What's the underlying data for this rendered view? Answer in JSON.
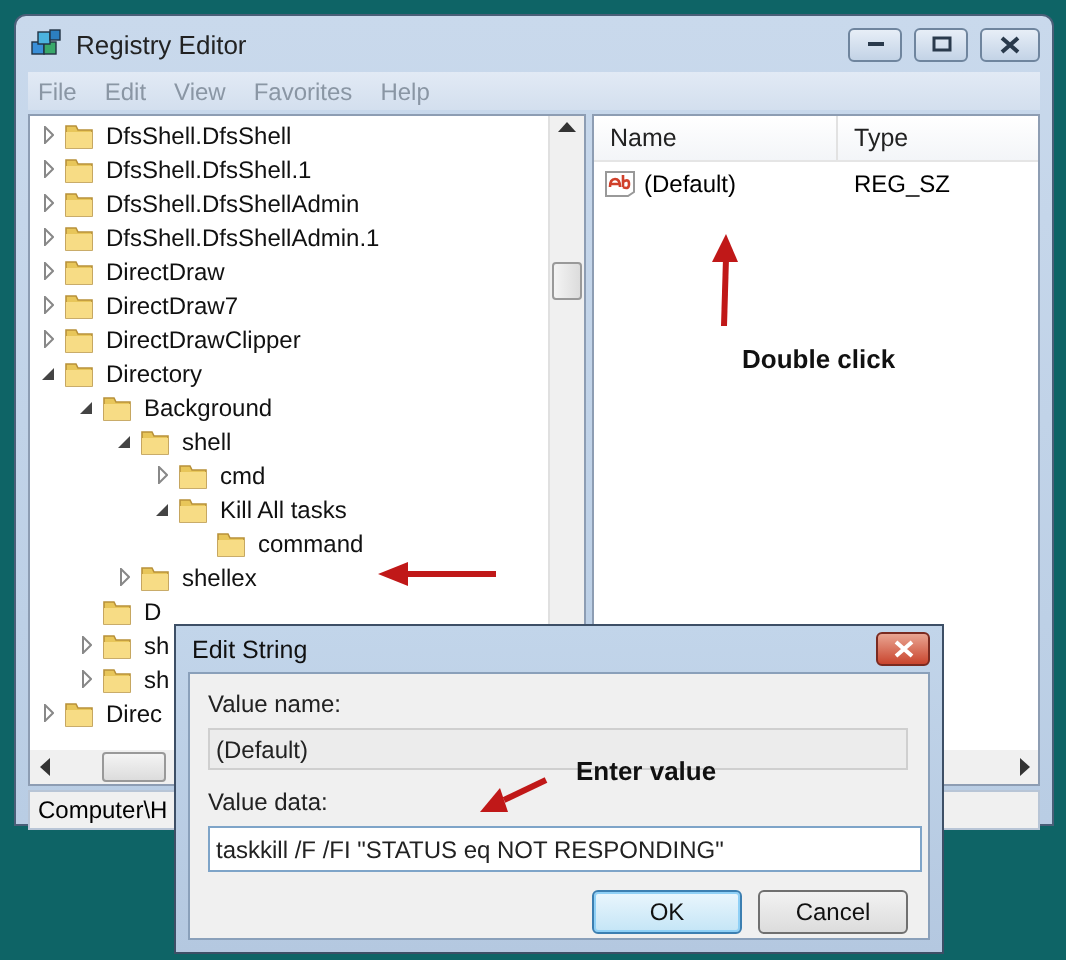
{
  "window": {
    "title": "Registry Editor",
    "menu": [
      "File",
      "Edit",
      "View",
      "Favorites",
      "Help"
    ]
  },
  "tree": {
    "items": [
      {
        "label": "DfsShell.DfsShell",
        "expanded": false
      },
      {
        "label": "DfsShell.DfsShell.1",
        "expanded": false
      },
      {
        "label": "DfsShell.DfsShellAdmin",
        "expanded": false
      },
      {
        "label": "DfsShell.DfsShellAdmin.1",
        "expanded": false
      },
      {
        "label": "DirectDraw",
        "expanded": false
      },
      {
        "label": "DirectDraw7",
        "expanded": false
      },
      {
        "label": "DirectDrawClipper",
        "expanded": false
      },
      {
        "label": "Directory",
        "expanded": true,
        "children": [
          {
            "label": "Background",
            "expanded": true,
            "children": [
              {
                "label": "shell",
                "expanded": true,
                "children": [
                  {
                    "label": "cmd",
                    "expanded": false
                  },
                  {
                    "label": "Kill All tasks",
                    "expanded": true,
                    "children": [
                      {
                        "label": "command"
                      }
                    ]
                  }
                ]
              },
              {
                "label": "shellex",
                "expanded": false
              }
            ]
          },
          {
            "label": "D"
          },
          {
            "label": "sh",
            "expanded": false
          },
          {
            "label": "sh",
            "expanded": false
          }
        ]
      },
      {
        "label": "Direc",
        "expanded": false
      }
    ]
  },
  "list": {
    "columns": [
      "Name",
      "Type"
    ],
    "rows": [
      {
        "name": "(Default)",
        "type": "REG_SZ"
      }
    ]
  },
  "status_bar": "Computer\\H",
  "dialog": {
    "title": "Edit String",
    "value_name_label": "Value name:",
    "value_name": "(Default)",
    "value_name_disabled": true,
    "value_data_label": "Value data:",
    "value_data": "taskkill /F /FI \"STATUS eq NOT RESPONDING\"",
    "buttons": [
      {
        "label": "OK",
        "default": true
      },
      {
        "label": "Cancel",
        "default": false
      }
    ]
  },
  "annotations": [
    {
      "text": "Double click"
    },
    {
      "text": "Enter value"
    }
  ]
}
